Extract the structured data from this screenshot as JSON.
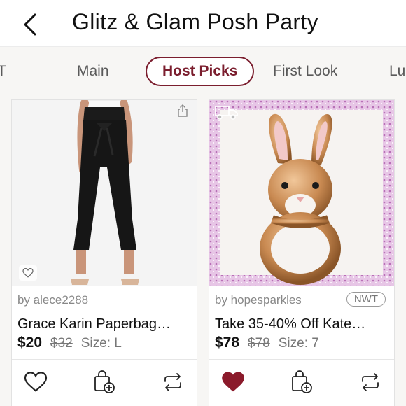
{
  "header": {
    "title": "Glitz & Glam Posh Party",
    "back_icon": "chevron-left-icon"
  },
  "tabs": [
    {
      "label": "T",
      "active": false
    },
    {
      "label": "Main",
      "active": false
    },
    {
      "label": "Host Picks",
      "active": true
    },
    {
      "label": "First Look",
      "active": false
    },
    {
      "label": "Lu",
      "active": false
    }
  ],
  "listings": [
    {
      "seller": "by alece2288",
      "title": "Grace Karin Paperbag…",
      "price": "$20",
      "original_price": "$32",
      "size": "Size: L",
      "badge": "",
      "liked": false,
      "photo_icons": [
        "share-icon",
        "small-heart-icon"
      ]
    },
    {
      "seller": "by hopesparkles",
      "title": "Take 35-40% Off Kate…",
      "price": "$78",
      "original_price": "$78",
      "size": "Size: 7",
      "badge": "NWT",
      "liked": true,
      "photo_icons": [
        "truck-icon"
      ]
    }
  ],
  "colors": {
    "accent": "#7b1e2e",
    "heart_filled": "#8b1a2b"
  }
}
